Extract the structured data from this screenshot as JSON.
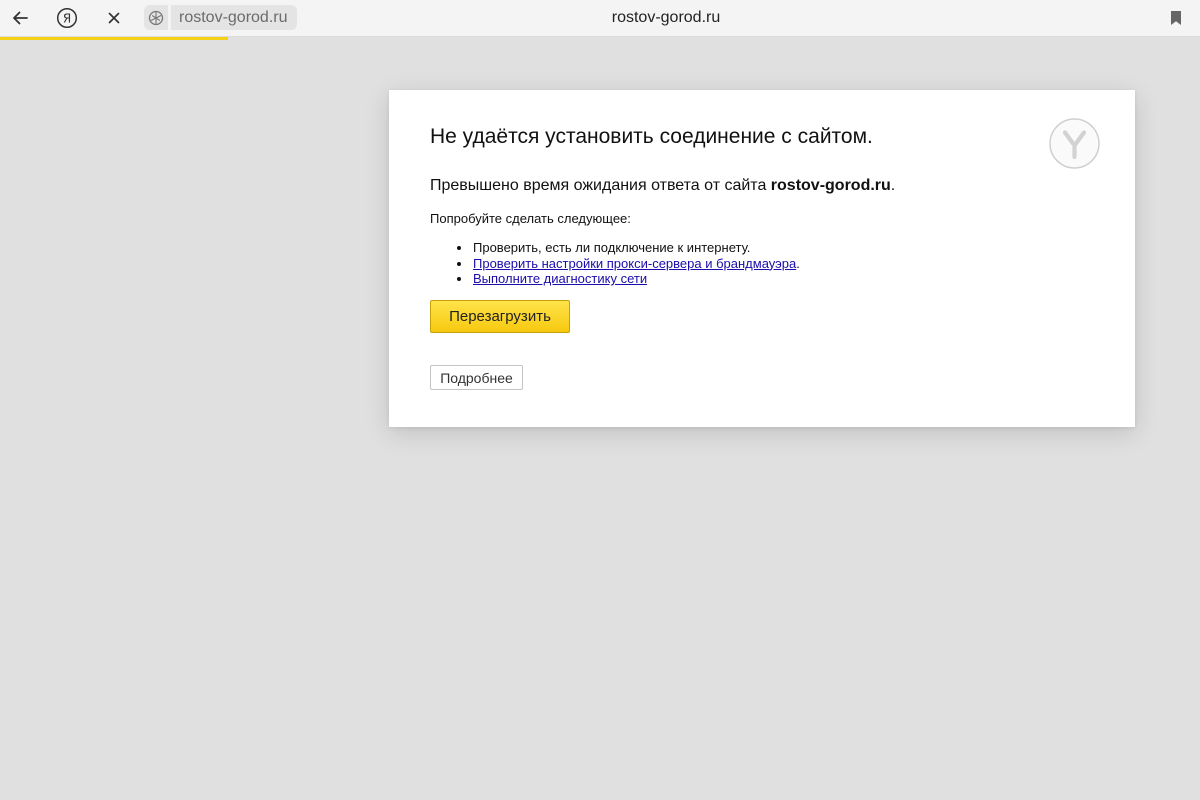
{
  "browser": {
    "tab_site": "rostov-gorod.ru",
    "page_title": "rostov-gorod.ru",
    "ya_button_glyph": "Я",
    "icons": {
      "back": "back-arrow-icon",
      "yandex": "yandex-logo-icon",
      "stop": "close-icon",
      "site": "site-shield-icon",
      "bookmark": "bookmark-icon"
    },
    "loading_progress": 0.19,
    "accent_color": "#f5d115"
  },
  "error_page": {
    "title": "Не удаётся установить соединение с сайтом.",
    "description_prefix": "Превышено время ожидания ответа от сайта ",
    "site": "rostov-gorod.ru",
    "description_suffix": ".",
    "try_text": "Попробуйте сделать следующее:",
    "suggestions": [
      {
        "text": "Проверить, есть ли подключение к интернету."
      },
      {
        "link": "Проверить настройки прокси-сервера и брандмауэра",
        "after": "."
      },
      {
        "link": "Выполните диагностику сети"
      }
    ],
    "reload_button": "Перезагрузить",
    "details_button": "Подробнее",
    "logo_icon": "yandex-browser-logo",
    "link_color": "#1a0dab",
    "button_color": "#f6c90f"
  }
}
